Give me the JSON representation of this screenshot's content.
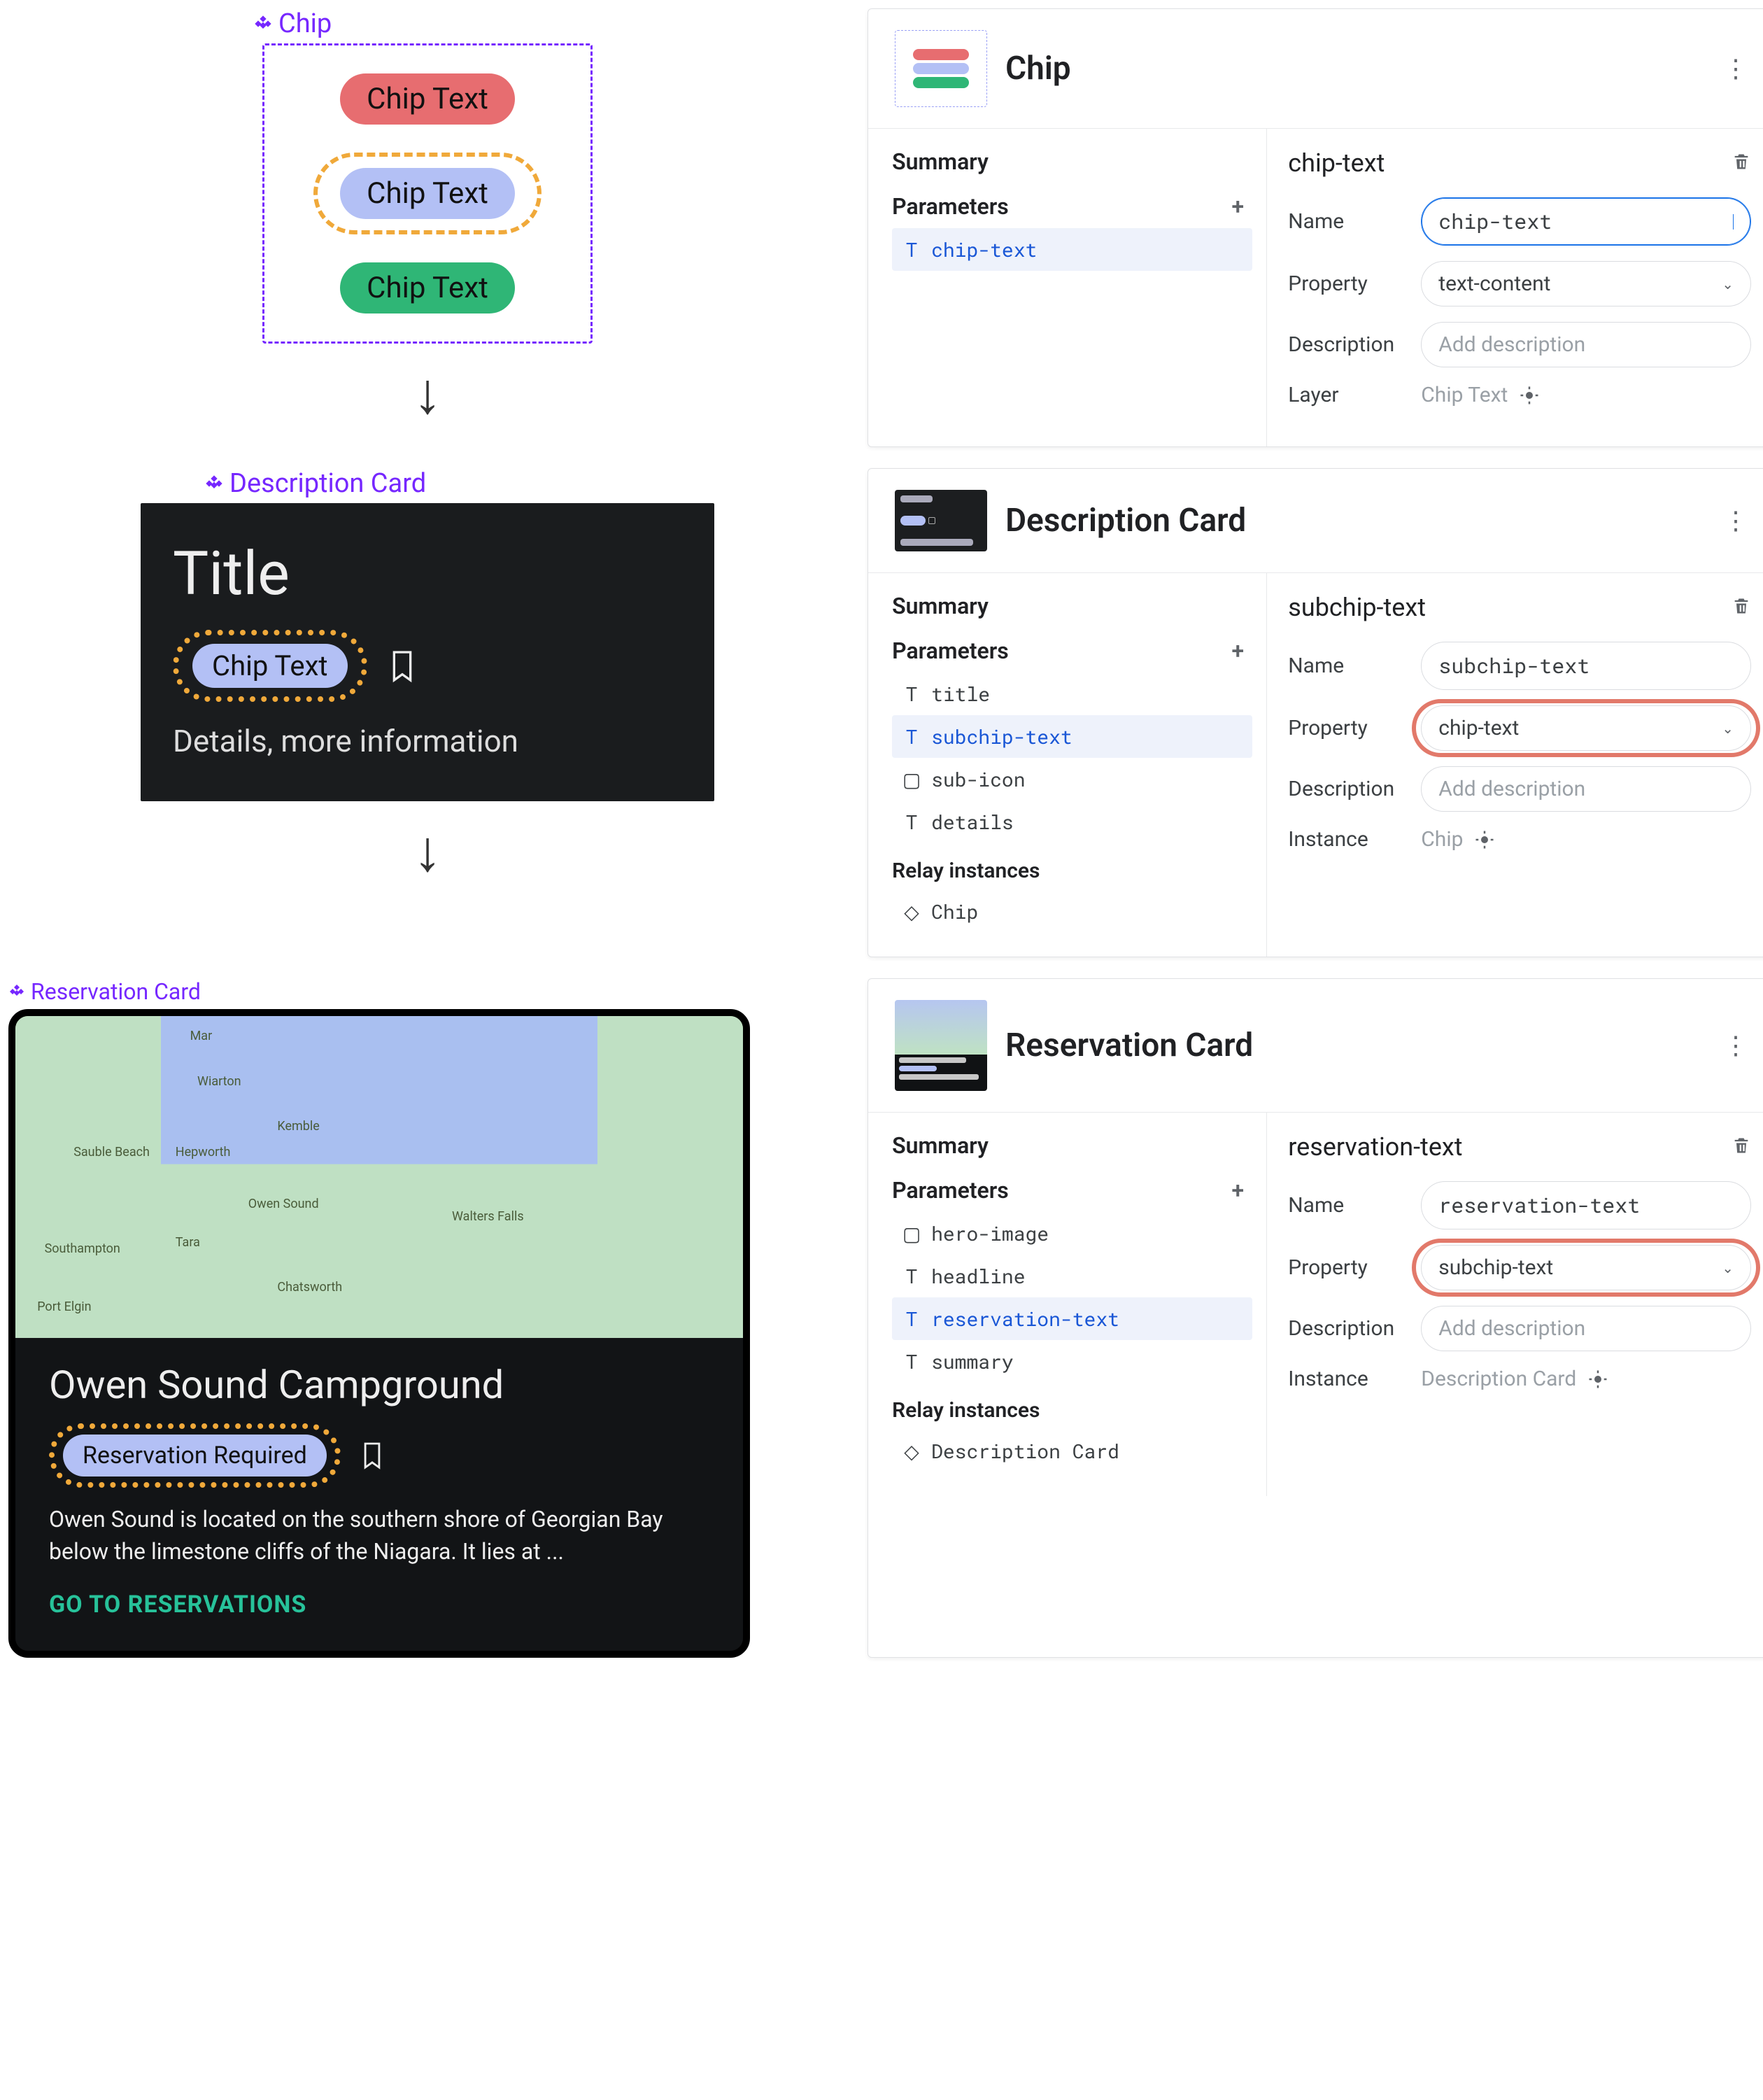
{
  "labels": {
    "chip": "Chip",
    "description_card": "Description Card",
    "reservation_card": "Reservation Card"
  },
  "chip_preview": {
    "red": "Chip Text",
    "blue": "Chip Text",
    "green": "Chip Text"
  },
  "dc_preview": {
    "title": "Title",
    "chip": "Chip Text",
    "details": "Details, more information"
  },
  "rc_preview": {
    "headline": "Owen Sound Campground",
    "chip": "Reservation Required",
    "summary": "Owen Sound is located on the southern shore of Georgian Bay below the limestone cliffs of the Niagara. It lies at ...",
    "cta": "GO TO RESERVATIONS",
    "map_labels": [
      "Mar",
      "Wiarton",
      "Sauble Beach",
      "Hepworth",
      "Kemble",
      "Owen Sound",
      "Walters Falls",
      "Southampton",
      "Tara",
      "Chatsworth",
      "Port Elgin"
    ]
  },
  "panel_chip": {
    "title": "Chip",
    "summary_label": "Summary",
    "parameters_label": "Parameters",
    "param_active": "chip-text",
    "right_header": "chip-text",
    "rows": {
      "name": {
        "label": "Name",
        "value": "chip-text"
      },
      "property": {
        "label": "Property",
        "value": "text-content"
      },
      "description": {
        "label": "Description",
        "placeholder": "Add description"
      },
      "layer": {
        "label": "Layer",
        "value": "Chip Text"
      }
    }
  },
  "panel_dc": {
    "title": "Description Card",
    "summary_label": "Summary",
    "parameters_label": "Parameters",
    "params": [
      "title",
      "subchip-text",
      "sub-icon",
      "details"
    ],
    "param_active": "subchip-text",
    "param_glyphs": [
      "T",
      "T",
      "□",
      "T"
    ],
    "relay_label": "Relay instances",
    "relay_items": [
      "Chip"
    ],
    "right_header": "subchip-text",
    "rows": {
      "name": {
        "label": "Name",
        "value": "subchip-text"
      },
      "property": {
        "label": "Property",
        "value": "chip-text"
      },
      "description": {
        "label": "Description",
        "placeholder": "Add description"
      },
      "instance": {
        "label": "Instance",
        "value": "Chip"
      }
    }
  },
  "panel_rc": {
    "title": "Reservation Card",
    "summary_label": "Summary",
    "parameters_label": "Parameters",
    "params": [
      "hero-image",
      "headline",
      "reservation-text",
      "summary"
    ],
    "param_glyphs": [
      "□",
      "T",
      "T",
      "T"
    ],
    "param_active": "reservation-text",
    "relay_label": "Relay instances",
    "relay_items": [
      "Description Card"
    ],
    "right_header": "reservation-text",
    "rows": {
      "name": {
        "label": "Name",
        "value": "reservation-text"
      },
      "property": {
        "label": "Property",
        "value": "subchip-text"
      },
      "description": {
        "label": "Description",
        "placeholder": "Add description"
      },
      "instance": {
        "label": "Instance",
        "value": "Description Card"
      }
    }
  }
}
